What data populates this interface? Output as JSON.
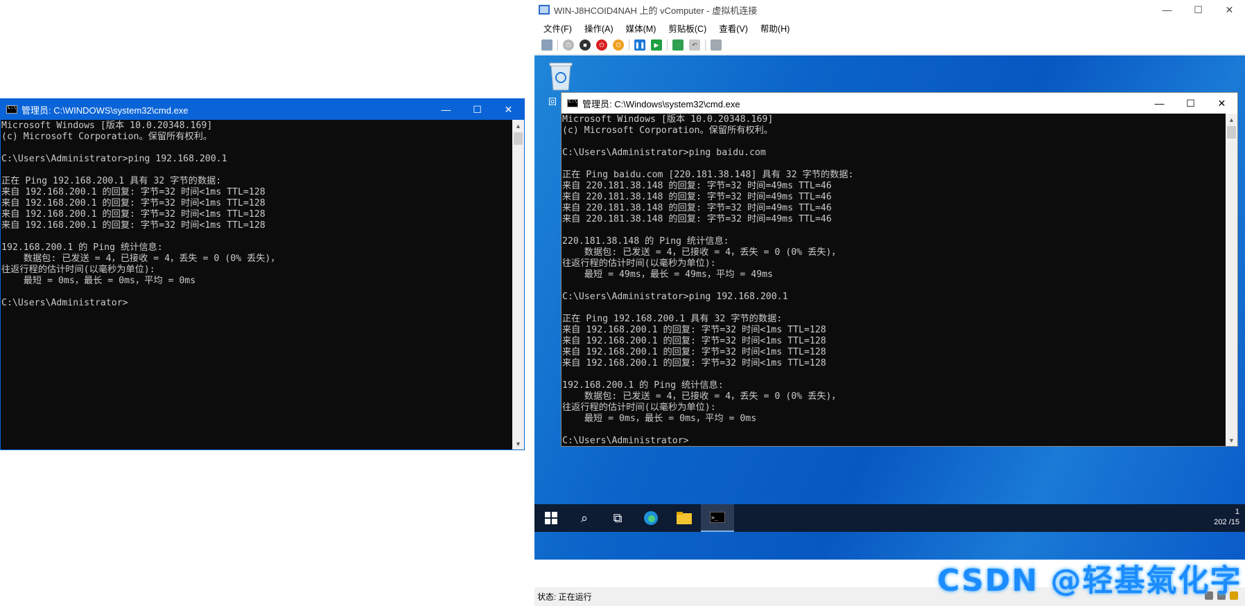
{
  "host_cmd": {
    "title": "管理员: C:\\WINDOWS\\system32\\cmd.exe",
    "minimize": "—",
    "maximize": "☐",
    "close": "✕",
    "console_text": "Microsoft Windows [版本 10.0.20348.169]\n(c) Microsoft Corporation。保留所有权利。\n\nC:\\Users\\Administrator>ping 192.168.200.1\n\n正在 Ping 192.168.200.1 具有 32 字节的数据:\n来自 192.168.200.1 的回复: 字节=32 时间<1ms TTL=128\n来自 192.168.200.1 的回复: 字节=32 时间<1ms TTL=128\n来自 192.168.200.1 的回复: 字节=32 时间<1ms TTL=128\n来自 192.168.200.1 的回复: 字节=32 时间<1ms TTL=128\n\n192.168.200.1 的 Ping 统计信息:\n    数据包: 已发送 = 4，已接收 = 4，丢失 = 0 (0% 丢失)，\n往返行程的估计时间(以毫秒为单位):\n    最短 = 0ms，最长 = 0ms，平均 = 0ms\n\nC:\\Users\\Administrator>"
  },
  "vm": {
    "title": "WIN-J8HCOID4NAH 上的 vComputer - 虚拟机连接",
    "minimize": "—",
    "maximize": "☐",
    "close": "✕",
    "menu": [
      "文件(F)",
      "操作(A)",
      "媒体(M)",
      "剪贴板(C)",
      "查看(V)",
      "帮助(H)"
    ],
    "desktop": {
      "recycle_bin_label": "回"
    },
    "cmd": {
      "title": "管理员: C:\\Windows\\system32\\cmd.exe",
      "minimize": "—",
      "maximize": "☐",
      "close": "✕",
      "console_text": "Microsoft Windows [版本 10.0.20348.169]\n(c) Microsoft Corporation。保留所有权利。\n\nC:\\Users\\Administrator>ping baidu.com\n\n正在 Ping baidu.com [220.181.38.148] 具有 32 字节的数据:\n来自 220.181.38.148 的回复: 字节=32 时间=49ms TTL=46\n来自 220.181.38.148 的回复: 字节=32 时间=49ms TTL=46\n来自 220.181.38.148 的回复: 字节=32 时间=49ms TTL=46\n来自 220.181.38.148 的回复: 字节=32 时间=49ms TTL=46\n\n220.181.38.148 的 Ping 统计信息:\n    数据包: 已发送 = 4，已接收 = 4，丢失 = 0 (0% 丢失)，\n往返行程的估计时间(以毫秒为单位):\n    最短 = 49ms，最长 = 49ms，平均 = 49ms\n\nC:\\Users\\Administrator>ping 192.168.200.1\n\n正在 Ping 192.168.200.1 具有 32 字节的数据:\n来自 192.168.200.1 的回复: 字节=32 时间<1ms TTL=128\n来自 192.168.200.1 的回复: 字节=32 时间<1ms TTL=128\n来自 192.168.200.1 的回复: 字节=32 时间<1ms TTL=128\n来自 192.168.200.1 的回复: 字节=32 时间<1ms TTL=128\n\n192.168.200.1 的 Ping 统计信息:\n    数据包: 已发送 = 4，已接收 = 4，丢失 = 0 (0% 丢失)，\n往返行程的估计时间(以毫秒为单位):\n    最短 = 0ms，最长 = 0ms，平均 = 0ms\n\nC:\\Users\\Administrator>"
    },
    "tray": {
      "time": "1",
      "date": "202  /15"
    },
    "status": "状态: 正在运行"
  },
  "watermark": "CSDN @轻基氣化字",
  "colors": {
    "host_titlebar": "#0a64d8",
    "console_bg": "#0c0c0c",
    "console_fg": "#cccccc",
    "taskbar": "#0d1b33",
    "watermark": "#1c8cff"
  }
}
